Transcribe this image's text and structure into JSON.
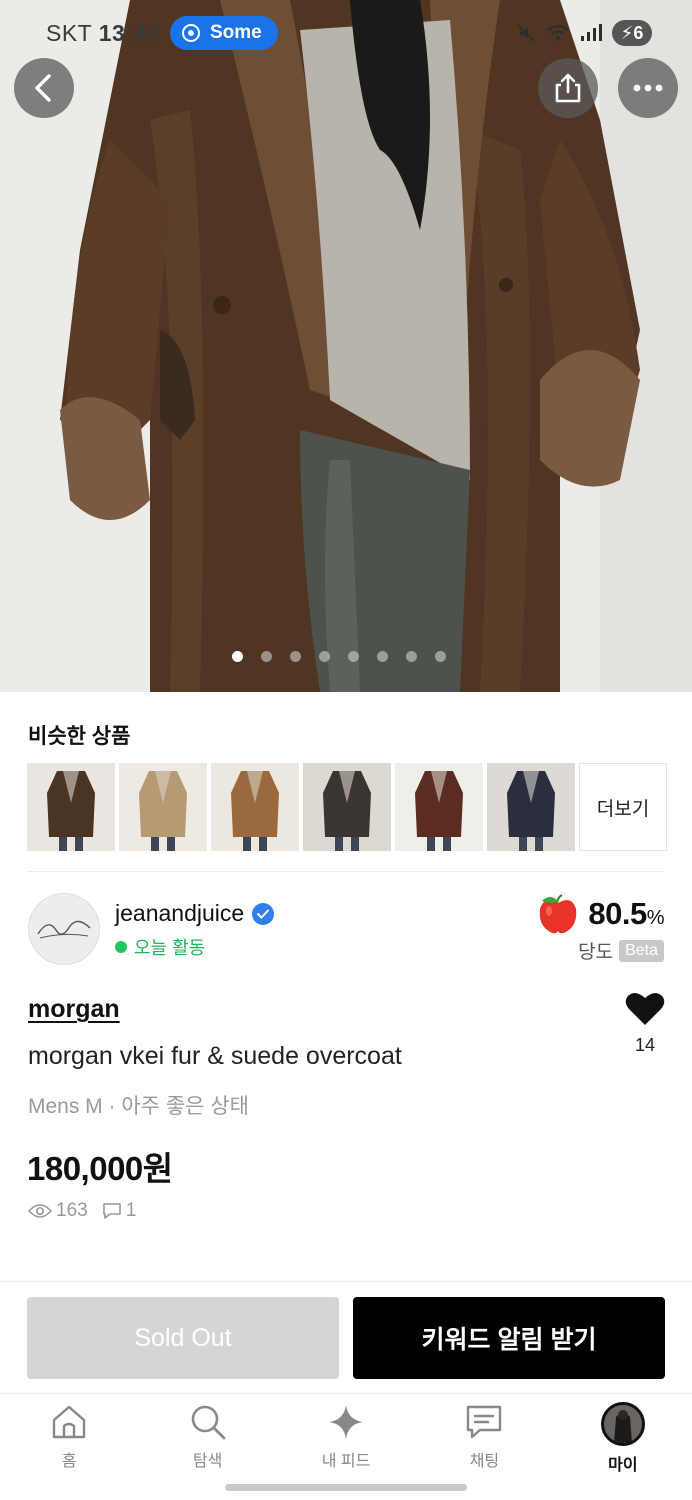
{
  "status_bar": {
    "carrier": "SKT",
    "time": "13:40",
    "pill_label": "Some",
    "battery": "6"
  },
  "hero": {
    "image_count": 8,
    "active_index": 0,
    "icons": {
      "back": "chevron-left-icon",
      "share": "share-icon",
      "more": "more-icon"
    }
  },
  "similar": {
    "title": "비슷한 상품",
    "more_label": "더보기",
    "thumbs": [
      {
        "coat": "#4a3423",
        "bg": "#e9e6e1"
      },
      {
        "coat": "#b59a73",
        "bg": "#eeeae3"
      },
      {
        "coat": "#9a6a3e",
        "bg": "#ece7df"
      },
      {
        "coat": "#3a3530",
        "bg": "#dcd8d2"
      },
      {
        "coat": "#5a2c22",
        "bg": "#f0eeea"
      },
      {
        "coat": "#2a2e3e",
        "bg": "#dddad6"
      }
    ]
  },
  "seller": {
    "name": "jeanandjuice",
    "activity": "오늘 활동",
    "score_value": "80.5",
    "score_unit": "%",
    "score_label": "당도",
    "beta_label": "Beta",
    "colors": {
      "active": "#22c55e",
      "verified": "#2f80ed",
      "apple": "#e8332a"
    }
  },
  "product": {
    "brand": "morgan",
    "title": "morgan vkei fur & suede overcoat",
    "meta": "Mens M · 아주 좋은 상태",
    "price": "180,000원",
    "likes": "14",
    "views": "163",
    "comments": "1"
  },
  "actions": {
    "sold_out": "Sold Out",
    "keyword_alert": "키워드 알림 받기"
  },
  "tabs": [
    {
      "label": "홈",
      "icon": "home-icon"
    },
    {
      "label": "탐색",
      "icon": "search-icon"
    },
    {
      "label": "내 피드",
      "icon": "sparkle-icon"
    },
    {
      "label": "채팅",
      "icon": "chat-icon"
    },
    {
      "label": "마이",
      "icon": "profile-avatar",
      "active": true
    }
  ]
}
